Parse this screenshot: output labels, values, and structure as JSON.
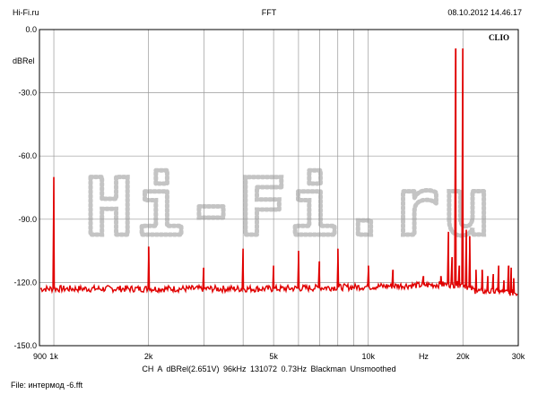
{
  "header": {
    "left": "Hi-Fi.ru",
    "center": "FFT",
    "right": "08.10.2012 14.46.17"
  },
  "footer": {
    "settings": "CH A   dBRel(2.651V)   96kHz   131072   0.73Hz   Blackman   Unsmoothed",
    "file": "File: интермод -6.fft"
  },
  "watermark": "Hi-Fi.ru",
  "chart_data": {
    "type": "line",
    "title": "FFT",
    "brand_label": "CLIO",
    "ylabel": "dBRel",
    "xlabel": "Hz",
    "x_scale": "log",
    "xlim": [
      900,
      30000
    ],
    "ylim": [
      -150,
      0
    ],
    "y_ticks": [
      0,
      -30,
      -60,
      -90,
      -120,
      -150
    ],
    "y_tick_labels": [
      "0.0",
      "-30.0",
      "-60.0",
      "-90.0",
      "-120.0",
      "-150.0"
    ],
    "x_ticks": [
      900,
      1000,
      2000,
      5000,
      10000,
      20000,
      30000
    ],
    "x_tick_labels": [
      "900",
      "1k",
      "2k",
      "5k",
      "10k",
      "20k",
      "30k"
    ],
    "x_unit_label_position": 15000,
    "grid": true,
    "line_color": "#e00000",
    "noise_floor": [
      {
        "x": 900,
        "y": -123
      },
      {
        "x": 5000,
        "y": -123
      },
      {
        "x": 10000,
        "y": -122
      },
      {
        "x": 17000,
        "y": -121
      },
      {
        "x": 20000,
        "y": -121
      },
      {
        "x": 22000,
        "y": -124
      },
      {
        "x": 30000,
        "y": -125
      }
    ],
    "peaks": [
      {
        "x": 1000,
        "y": -70
      },
      {
        "x": 2000,
        "y": -103
      },
      {
        "x": 3000,
        "y": -113
      },
      {
        "x": 4000,
        "y": -104
      },
      {
        "x": 5000,
        "y": -112
      },
      {
        "x": 6000,
        "y": -105
      },
      {
        "x": 7000,
        "y": -110
      },
      {
        "x": 8000,
        "y": -104
      },
      {
        "x": 10000,
        "y": -112
      },
      {
        "x": 12000,
        "y": -114
      },
      {
        "x": 15000,
        "y": -117
      },
      {
        "x": 17000,
        "y": -117
      },
      {
        "x": 18000,
        "y": -96
      },
      {
        "x": 18500,
        "y": -108
      },
      {
        "x": 19000,
        "y": -9
      },
      {
        "x": 19500,
        "y": -112
      },
      {
        "x": 20000,
        "y": -9
      },
      {
        "x": 20500,
        "y": -95
      },
      {
        "x": 21000,
        "y": -98
      },
      {
        "x": 22000,
        "y": -114
      },
      {
        "x": 23000,
        "y": -114
      },
      {
        "x": 24000,
        "y": -117
      },
      {
        "x": 25000,
        "y": -116
      },
      {
        "x": 26000,
        "y": -112
      },
      {
        "x": 27000,
        "y": -119
      },
      {
        "x": 28000,
        "y": -112
      },
      {
        "x": 28500,
        "y": -113
      },
      {
        "x": 29000,
        "y": -118
      }
    ]
  }
}
